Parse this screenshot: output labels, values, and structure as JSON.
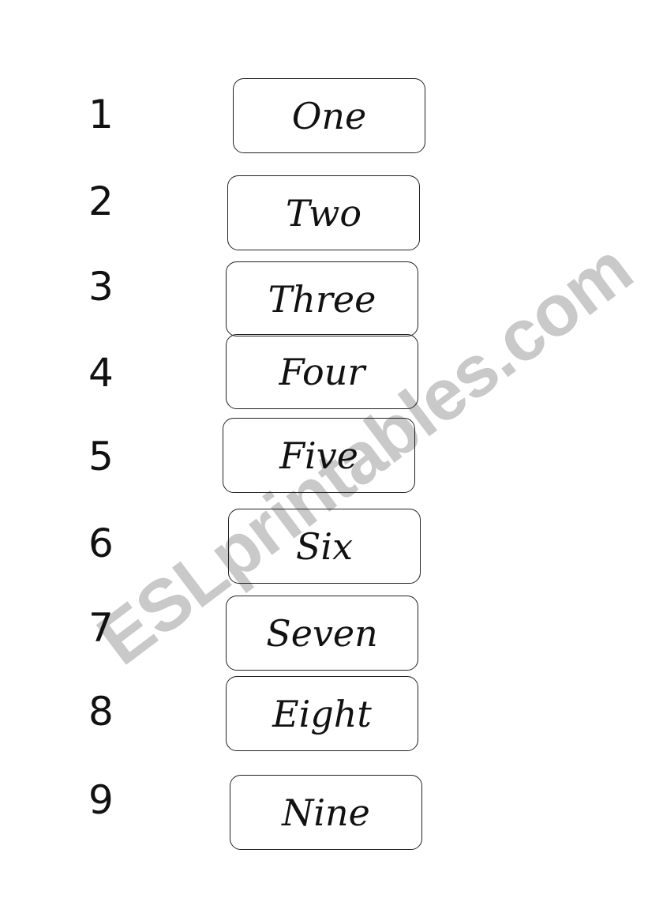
{
  "watermark": {
    "text": "ESLprintables.com",
    "color": "#c9c9c9"
  },
  "items": [
    {
      "number": "1",
      "word": "One"
    },
    {
      "number": "2",
      "word": "Two"
    },
    {
      "number": "3",
      "word": "Three"
    },
    {
      "number": "4",
      "word": "Four"
    },
    {
      "number": "5",
      "word": "Five"
    },
    {
      "number": "6",
      "word": "Six"
    },
    {
      "number": "7",
      "word": "Seven"
    },
    {
      "number": "8",
      "word": "Eight"
    },
    {
      "number": "9",
      "word": "Nine"
    }
  ]
}
